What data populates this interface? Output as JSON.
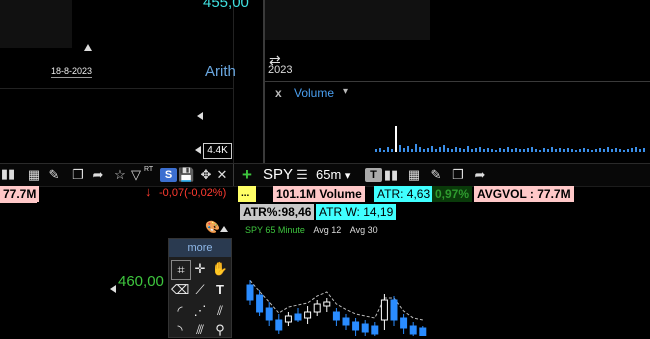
{
  "left_top_pane": {
    "price_label": "455,00",
    "date_label": "18-8-2023",
    "scale_label": "Arith",
    "value_tag": "4.4K"
  },
  "right_top_pane": {
    "date_label": "2023",
    "volume_panel": {
      "close_glyph": "x",
      "title": "Volume",
      "dropdown_glyph": "▾"
    },
    "volume_bars": [
      3,
      4,
      2,
      5,
      3,
      26,
      7,
      4,
      6,
      3,
      8,
      5,
      3,
      4,
      6,
      3,
      5,
      7,
      4,
      3,
      5,
      4,
      3,
      6,
      3,
      4,
      5,
      3,
      4,
      3,
      2,
      4,
      3,
      5,
      3,
      4,
      3,
      3,
      4,
      5,
      3,
      2,
      4,
      3,
      5,
      3,
      4,
      3,
      4,
      3,
      2,
      3,
      4,
      3,
      2,
      3,
      4,
      3,
      5,
      3,
      4,
      3,
      2,
      3,
      4,
      5,
      3,
      4
    ]
  },
  "left_toolbar": {
    "left_value": "77.7M",
    "rt_label": "RT",
    "s_label": "S",
    "change_text": "-0,07(-0,02%)",
    "colors": {
      "change": "#ff3b30",
      "value_bg": "#ffc8c8"
    }
  },
  "right_toolbar": {
    "symbol": "SPY",
    "timeframe": "65m",
    "dropdown_glyph": "▾",
    "t_label": "T"
  },
  "indicators": {
    "ellipsis": "...",
    "volume_label": "101.1M Volume",
    "atr_label": "ATR: 4,63",
    "pct_label": "0,97%",
    "avgvol_label": "AVGVOL : 77.7M",
    "atr_pct_label": "ATR%:98,46",
    "atr_w_label": "ATR W: 14,19",
    "colors": {
      "yellow": "#ffff66",
      "pink": "#ffc8c8",
      "cyan": "#40ffff",
      "green": "#2e8b2e",
      "grey": "#c8c8c8"
    }
  },
  "legend": {
    "series1": "SPY 65 Minute",
    "series2": "Avg 12",
    "series3": "Avg 30",
    "colors": {
      "series1": "#3ec63e",
      "series2": "#dddddd",
      "series3": "#dddddd"
    }
  },
  "left_bottom_pane": {
    "price_label": "460,00",
    "more_label": "more"
  },
  "candles": [
    {
      "o": 285,
      "c": 300,
      "h": 280,
      "l": 305
    },
    {
      "o": 295,
      "c": 312,
      "h": 290,
      "l": 316
    },
    {
      "o": 308,
      "c": 320,
      "h": 302,
      "l": 326
    },
    {
      "o": 320,
      "c": 330,
      "h": 314,
      "l": 334
    },
    {
      "o": 322,
      "c": 316,
      "h": 312,
      "l": 326
    },
    {
      "o": 314,
      "c": 320,
      "h": 308,
      "l": 322
    },
    {
      "o": 318,
      "c": 312,
      "h": 306,
      "l": 324
    },
    {
      "o": 312,
      "c": 304,
      "h": 300,
      "l": 316
    },
    {
      "o": 306,
      "c": 302,
      "h": 298,
      "l": 312
    },
    {
      "o": 312,
      "c": 320,
      "h": 308,
      "l": 326
    },
    {
      "o": 318,
      "c": 325,
      "h": 314,
      "l": 330
    },
    {
      "o": 322,
      "c": 330,
      "h": 318,
      "l": 336
    },
    {
      "o": 324,
      "c": 332,
      "h": 320,
      "l": 336
    },
    {
      "o": 326,
      "c": 334,
      "h": 322,
      "l": 336
    },
    {
      "o": 320,
      "c": 300,
      "h": 294,
      "l": 330
    },
    {
      "o": 300,
      "c": 320,
      "h": 296,
      "l": 326
    },
    {
      "o": 318,
      "c": 328,
      "h": 314,
      "l": 334
    },
    {
      "o": 326,
      "c": 334,
      "h": 322,
      "l": 336
    },
    {
      "o": 328,
      "c": 336,
      "h": 326,
      "l": 336
    }
  ]
}
